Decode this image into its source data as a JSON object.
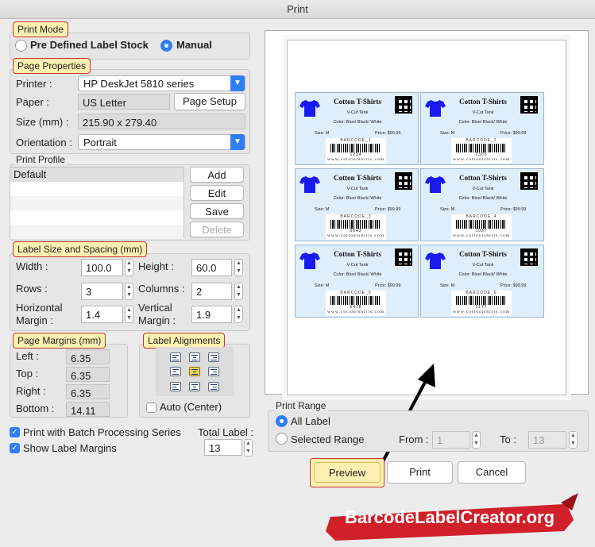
{
  "window": {
    "title": "Print"
  },
  "print_mode": {
    "legend": "Print Mode",
    "option_predefined": "Pre Defined Label Stock",
    "option_manual": "Manual",
    "selected": "Manual"
  },
  "page_properties": {
    "legend": "Page Properties",
    "printer_label": "Printer :",
    "printer_value": "HP DeskJet 5810 series",
    "paper_label": "Paper :",
    "paper_value": "US Letter",
    "page_setup_button": "Page Setup",
    "size_label": "Size (mm) :",
    "size_value": "215.90 x 279.40",
    "orientation_label": "Orientation :",
    "orientation_value": "Portrait"
  },
  "print_profile": {
    "legend": "Print Profile",
    "items": [
      "Default"
    ],
    "add_button": "Add",
    "edit_button": "Edit",
    "save_button": "Save",
    "delete_button": "Delete"
  },
  "label_size": {
    "legend": "Label Size and Spacing (mm)",
    "width_label": "Width :",
    "width_value": "100.0",
    "height_label": "Height :",
    "height_value": "60.0",
    "rows_label": "Rows :",
    "rows_value": "3",
    "columns_label": "Columns :",
    "columns_value": "2",
    "hmargin_label_1": "Horizontal",
    "hmargin_label_2": "Margin :",
    "hmargin_value": "1.4",
    "vmargin_label_1": "Vertical",
    "vmargin_label_2": "Margin :",
    "vmargin_value": "1.9"
  },
  "page_margins": {
    "legend": "Page Margins (mm)",
    "left_label": "Left :",
    "left_value": "6.35",
    "top_label": "Top :",
    "top_value": "6.35",
    "right_label": "Right :",
    "right_value": "6.35",
    "bottom_label": "Bottom :",
    "bottom_value": "14.11"
  },
  "label_alignments": {
    "legend": "Label Alignments",
    "auto_center": "Auto (Center)",
    "selected": "middle-center"
  },
  "options": {
    "batch": "Print with Batch Processing Series",
    "batch_checked": true,
    "show_margins": "Show Label Margins",
    "show_margins_checked": true,
    "total_label_label": "Total Label :",
    "total_label_value": "13"
  },
  "preview_labels": {
    "title": "Cotton T-Shirts",
    "product": "V-Cut Tank",
    "color": "Color: Blue/ Black/ White",
    "size": "Size: M",
    "price": "Price: $99.99",
    "url": "www.cottontshirts.com",
    "shirt_color": "#1a1aee",
    "items": [
      {
        "caption": "BARCODE_1",
        "number": "1234"
      },
      {
        "caption": "BARCODE_2",
        "number": "2303"
      },
      {
        "caption": "BARCODE_3",
        "number": "5643"
      },
      {
        "caption": "BARCODE_4",
        "number": "1037"
      },
      {
        "caption": "BARCODE_5",
        "number": "6478"
      },
      {
        "caption": "BARCODE_6",
        "number": "3177"
      }
    ]
  },
  "print_range": {
    "legend": "Print Range",
    "all_label": "All Label",
    "selected_range": "Selected Range",
    "selected": "All Label",
    "from_label": "From :",
    "from_value": "1",
    "to_label": "To :",
    "to_value": "13"
  },
  "actions": {
    "preview": "Preview",
    "print": "Print",
    "cancel": "Cancel"
  },
  "brand": {
    "text": "BarcodeLabelCreator.org",
    "color": "#d0202a"
  },
  "colors": {
    "accent": "#2f7ef5",
    "highlight": "#fdf0b0",
    "highlight_border": "#c0392b"
  }
}
